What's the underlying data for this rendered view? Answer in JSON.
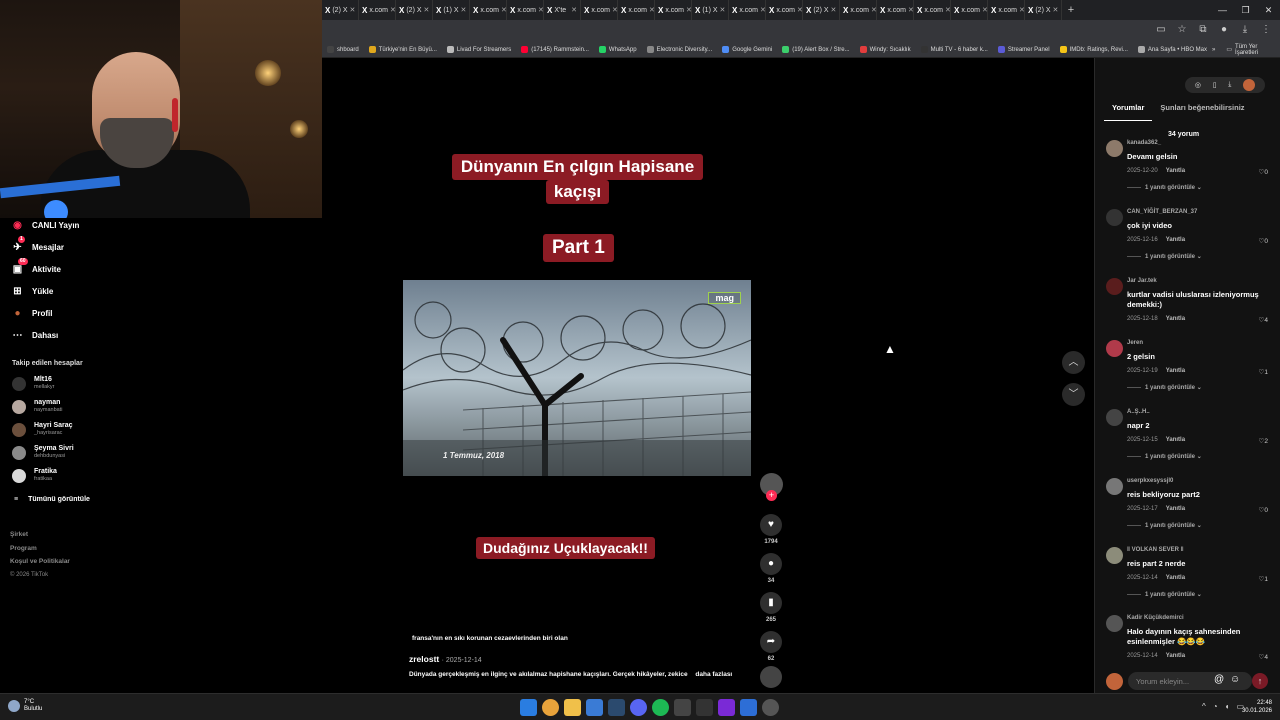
{
  "browser": {
    "tabs": [
      {
        "label": "(2) X"
      },
      {
        "label": "x.com"
      },
      {
        "label": "(2) X"
      },
      {
        "label": "(1) X"
      },
      {
        "label": "x.com"
      },
      {
        "label": "x.com"
      },
      {
        "label": "X'te"
      },
      {
        "label": "x.com"
      },
      {
        "label": "x.com"
      },
      {
        "label": "x.com"
      },
      {
        "label": "(1) X"
      },
      {
        "label": "x.com"
      },
      {
        "label": "x.com"
      },
      {
        "label": "(2) X"
      },
      {
        "label": "x.com"
      },
      {
        "label": "x.com"
      },
      {
        "label": "x.com"
      },
      {
        "label": "x.com"
      },
      {
        "label": "x.com"
      },
      {
        "label": "(2) X"
      }
    ],
    "bookmarks": [
      {
        "label": "shboard",
        "color": "#444"
      },
      {
        "label": "Türkiye'nin En Büyü...",
        "color": "#e0a81d"
      },
      {
        "label": "Livad For Streamers",
        "color": "#bbb"
      },
      {
        "label": "(17145) Rammstein...",
        "color": "#ff0033"
      },
      {
        "label": "WhatsApp",
        "color": "#25d366"
      },
      {
        "label": "Electronic Diversity...",
        "color": "#888"
      },
      {
        "label": "Google Gemini",
        "color": "#4f8df5"
      },
      {
        "label": "(19) Alert Box / Stre...",
        "color": "#3ccf6c"
      },
      {
        "label": "Windy: Sıcaklık",
        "color": "#e23d3d"
      },
      {
        "label": "Multi TV - 6 haber k...",
        "color": "#333"
      },
      {
        "label": "Streamer Panel",
        "color": "#5b5bd6"
      },
      {
        "label": "IMDb: Ratings, Revi...",
        "color": "#f5c518"
      },
      {
        "label": "Ana Sayfa • HBO Max",
        "color": "#aaa"
      }
    ],
    "bookmarks_all": "Tüm Yer İşaretleri"
  },
  "sidebar": {
    "nav": [
      {
        "label": "CANLI Yayın",
        "icon": "live-icon",
        "badge": ""
      },
      {
        "label": "Mesajlar",
        "icon": "messages-icon",
        "badge": "1"
      },
      {
        "label": "Aktivite",
        "icon": "activity-icon",
        "badge": "60"
      },
      {
        "label": "Yükle",
        "icon": "upload-icon",
        "badge": ""
      },
      {
        "label": "Profil",
        "icon": "profile-icon",
        "badge": ""
      },
      {
        "label": "Dahası",
        "icon": "more-icon",
        "badge": ""
      }
    ],
    "following_title": "Takip edilen hesaplar",
    "following": [
      {
        "name": "Mlt16",
        "handle": "mellakyr"
      },
      {
        "name": "nayman",
        "handle": "naymanbati"
      },
      {
        "name": "Hayri Saraç",
        "handle": "_hayrisarac"
      },
      {
        "name": "Şeyma Sivri",
        "handle": "dehbdunyasi"
      },
      {
        "name": "Fratika",
        "handle": "fratikaa"
      }
    ],
    "see_all": "Tümünü görüntüle",
    "footer": [
      "Şirket",
      "Program",
      "Koşul ve Politikalar"
    ],
    "copyright": "© 2026 TikTok"
  },
  "video": {
    "title_line1": "Dünyanın En çılgın Hapisane",
    "title_line2": "kaçışı",
    "part": "Part 1",
    "brand_logo": "mag",
    "overlay_date": "1 Temmuz, 2018",
    "subtitle": "Dudağınız Uçuklayacak!!",
    "caption": "fransa'nın en sıkı korunan cezaevlerinden biri olan",
    "author": "zrelostt",
    "post_date": "· 2025-12-14",
    "description": "Dünyada gerçekleşmiş en ilginç ve akılalmaz hapishane kaçışları. Gerçek hikâyeler, zekice",
    "more": "daha fazlası"
  },
  "actions": {
    "likes": "1794",
    "comments": "34",
    "saves": "265",
    "shares": "62"
  },
  "comments_panel": {
    "tab_comments": "Yorumlar",
    "tab_suggested": "Şunları beğenebilirsiniz",
    "count": "34 yorum",
    "reply_label": "Yanıtla",
    "view_reply": "1 yanıtı görüntüle",
    "input_placeholder": "Yorum ekleyin...",
    "comments": [
      {
        "user": "kanada362_",
        "text": "Devamı gelsin",
        "date": "2025-12-20",
        "likes": "0"
      },
      {
        "user": "CAN_YİĞİT_BERZAN_37",
        "text": "çok iyi video",
        "date": "2025-12-16",
        "likes": "0"
      },
      {
        "user": "Jar Jar.tek",
        "text": "kurtlar vadisi uluslarası izleniyormuş demekki:)",
        "date": "2025-12-18",
        "likes": "4"
      },
      {
        "user": "Jeren",
        "text": "2 gelsin",
        "date": "2025-12-19",
        "likes": "1"
      },
      {
        "user": "A..Ş..H..",
        "text": "napr 2",
        "date": "2025-12-15",
        "likes": "2"
      },
      {
        "user": "userpkxesyssjl0",
        "text": "reis bekliyoruz part2",
        "date": "2025-12-17",
        "likes": "0"
      },
      {
        "user": "‖ VOLKAN SEVER ‖",
        "text": "reis part 2 nerde",
        "date": "2025-12-14",
        "likes": "1"
      },
      {
        "user": "Kadir Küçükdemirci",
        "text": "Halo dayının kaçış sahnesinden esinlenmişler 😂😂😂",
        "date": "2025-12-14",
        "likes": "4"
      }
    ]
  },
  "taskbar": {
    "temp": "7°C",
    "weather": "Bulutlu",
    "time": "22:48",
    "date": "30.01.2026"
  }
}
